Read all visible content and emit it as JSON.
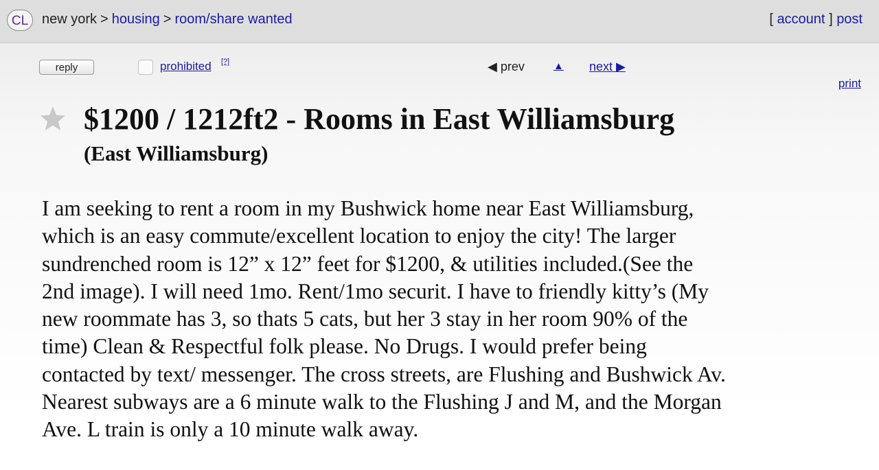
{
  "header": {
    "logo": "CL",
    "breadcrumb": [
      {
        "label": "new york",
        "link": false
      },
      {
        "label": "housing",
        "link": true
      },
      {
        "label": "room/share wanted",
        "link": true
      }
    ],
    "separator": ">",
    "bracket_open": "[",
    "account_label": "account",
    "bracket_close": "]",
    "post_label": "post"
  },
  "toolbar": {
    "reply_label": "reply",
    "prohibited_label": "prohibited",
    "help_label": "[?]",
    "prev_label": "◀ prev",
    "up_label": "▲",
    "next_label": "next ▶",
    "print_label": "print"
  },
  "posting": {
    "title": "$1200 / 1212ft2 - Rooms in East Williamsburg",
    "location": "(East Williamsburg)",
    "body_lines": [
      "I am seeking to rent a room in my Bushwick home near East Williamsburg,",
      "which is an easy commute/excellent location to enjoy the city! The larger",
      "sundrenched room is 12” x 12” feet for $1200, & utilities included.(See the",
      "2nd image). I will need 1mo. Rent/1mo securit. I have to friendly kitty’s (My",
      "new roommate has 3, so thats 5 cats, but her 3 stay in her room 90% of the",
      "time) Clean & Respectful folk please. No Drugs. I would prefer being",
      "contacted by text/ messenger. The cross streets, are Flushing and Bushwick Av.",
      "Nearest subways are a 6 minute walk to the Flushing J and M, and the Morgan",
      "Ave. L train is only a 10 minute walk away."
    ]
  },
  "colors": {
    "link": "#1a1aa6",
    "header_bg": "#dedede",
    "logo_text": "#5b2c8f",
    "star": "#c8c8c8"
  },
  "icons": {
    "favorite": "star-icon"
  }
}
